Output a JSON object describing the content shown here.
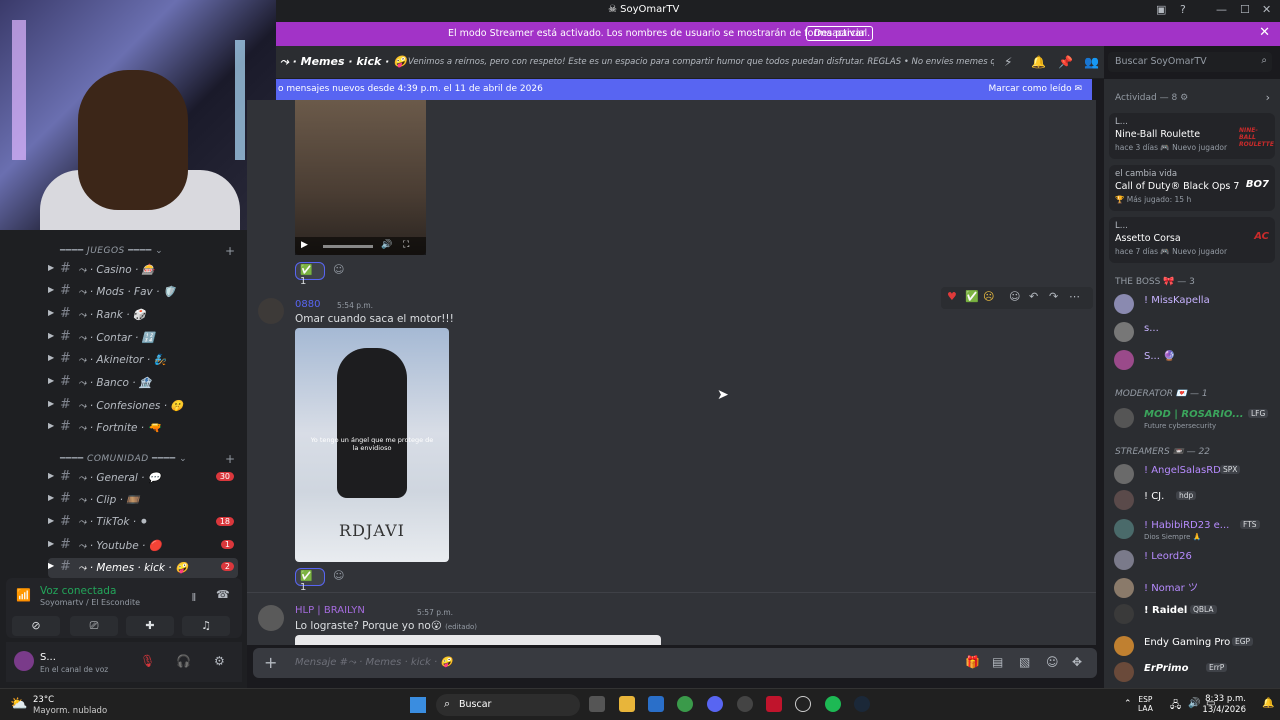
{
  "window": {
    "title": "SoyOmarTV"
  },
  "streamer_bar": {
    "message": "El modo Streamer está activado. Los nombres de usuario se mostrarán de forma parcial.",
    "button": "Desactivar"
  },
  "sidebar": {
    "categories": [
      {
        "label": "JUEGOS"
      },
      {
        "label": "COMUNIDAD"
      }
    ],
    "channels": [
      {
        "label": "⤳ · Casino · 🎰",
        "badge": ""
      },
      {
        "label": "⤳ · Mods · Fav · 🛡️",
        "badge": ""
      },
      {
        "label": "⤳ · Rank · 🎲",
        "badge": ""
      },
      {
        "label": "⤳ · Contar · 🔢",
        "badge": ""
      },
      {
        "label": "⤳ · Akineitor · 🧞",
        "badge": ""
      },
      {
        "label": "⤳ · Banco · 🏦",
        "badge": ""
      },
      {
        "label": "⤳ · Confesiones · 🤫",
        "badge": ""
      },
      {
        "label": "⤳ · Fortnite · 🔫",
        "badge": ""
      },
      {
        "label": "⤳ · General · 💬",
        "badge": "30"
      },
      {
        "label": "⤳ · Clip · 🎞️",
        "badge": ""
      },
      {
        "label": "⤳ · TikTok · ⚫",
        "badge": "18"
      },
      {
        "label": "⤳ · Youtube · 🔴",
        "badge": "1"
      },
      {
        "label": "⤳ · Memes · kick · 🤪",
        "badge": "2"
      }
    ]
  },
  "voice": {
    "status": "Voz conectada",
    "location": "Soyomartv / El Escondite"
  },
  "user": {
    "name": "S...",
    "status": "En el canal de voz"
  },
  "channel_header": {
    "name": "⤳ · Memes · kick · 🤪",
    "topic": "Venimos a reírnos, pero con respeto! Este es un espacio para compartir humor que todos puedan disfrutar. REGLAS  • No envíes memes que co..."
  },
  "search": {
    "placeholder": "Buscar SoyOmarTV"
  },
  "new_messages": {
    "text": "o mensajes nuevos desde 4:39 p.m. el 11 de abril de 2026",
    "action": "Marcar como leído"
  },
  "messages": [
    {
      "author": "0880",
      "time": "5:54 p.m.",
      "text": "Omar cuando saca el motor!!!",
      "image_caption": "Yo tengo un ángel que me protege de la envidioso",
      "image_brand": "RDJAVI",
      "reaction_count": "1"
    },
    {
      "author": "HLP | BRAILYN",
      "time": "5:57 p.m.",
      "text": "Lo lograste? Porque yo no😮",
      "edited": "(editado)"
    }
  ],
  "first_reaction_count": "1",
  "composer": {
    "placeholder": "Mensaje #⤳ · Memes · kick · 🤪"
  },
  "activity": {
    "header": "Actividad — 8",
    "items": [
      {
        "user": "L...",
        "game": "Nine-Ball Roulette",
        "meta": "hace 3 días  🎮 Nuevo jugador",
        "logo": "NINE-BALL ROULETTE"
      },
      {
        "user": "el cambia vida",
        "game": "Call of Duty® Black Ops 7",
        "meta": "🏆 Más jugado: 15 h",
        "logo": "BO7"
      },
      {
        "user": "L...",
        "game": "Assetto Corsa",
        "meta": "hace 7 días  🎮 Nuevo jugador",
        "logo": "AC"
      }
    ]
  },
  "member_groups": [
    {
      "header": "THE BOSS 🎀 — 3",
      "members": [
        {
          "name": "! MissKapella",
          "sub": ""
        },
        {
          "name": "s...",
          "sub": ""
        },
        {
          "name": "S... 🔮",
          "sub": ""
        }
      ]
    },
    {
      "header": "MODERATOR 💌 — 1",
      "members": [
        {
          "name": "MOD | ROSARIO...",
          "sub": "Future cybersecurity",
          "tag": "LFG"
        }
      ]
    },
    {
      "header": "STREAMERS 📼 — 22",
      "members": [
        {
          "name": "! AngelSalasRD",
          "sub": "",
          "tag": "SPX"
        },
        {
          "name": "! CJ.",
          "sub": "",
          "tag": "hdp"
        },
        {
          "name": "! HabibiRD23 e...",
          "sub": "Dios Siempre 🙏",
          "tag": "FTS"
        },
        {
          "name": "! Leord26",
          "sub": ""
        },
        {
          "name": "! Nomar ツ",
          "sub": ""
        },
        {
          "name": "! Raidel",
          "sub": "",
          "tag": "QBLA"
        },
        {
          "name": "Endy Gaming Pro",
          "sub": "",
          "tag": "EGP"
        },
        {
          "name": "ErPrimo",
          "sub": "",
          "tag": "ErrP"
        }
      ]
    }
  ],
  "taskbar": {
    "weather_temp": "23°C",
    "weather_desc": "Mayorm. nublado",
    "search": "Buscar",
    "lang1": "ESP",
    "lang2": "LAA",
    "time": "8:33 p.m.",
    "date": "13/4/2026"
  }
}
